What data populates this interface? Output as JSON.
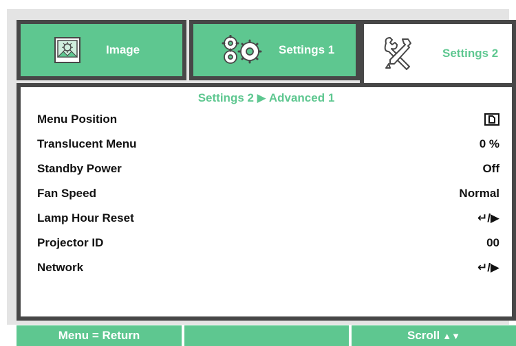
{
  "tabs": {
    "image": {
      "label": "Image",
      "icon": "image-icon"
    },
    "settings1": {
      "label": "Settings 1",
      "icon": "gears-icon"
    },
    "settings2": {
      "label": "Settings 2",
      "icon": "tools-icon"
    }
  },
  "breadcrumb": "Settings 2 ▶ Advanced 1",
  "menu_items": [
    {
      "label": "Menu Position",
      "value": "",
      "value_icon": "menu-position-icon"
    },
    {
      "label": "Translucent Menu",
      "value": "0 %"
    },
    {
      "label": "Standby Power",
      "value": "Off"
    },
    {
      "label": "Fan Speed",
      "value": "Normal"
    },
    {
      "label": "Lamp Hour Reset",
      "value": "↵/▶"
    },
    {
      "label": "Projector ID",
      "value": "00"
    },
    {
      "label": "Network",
      "value": "↵/▶"
    }
  ],
  "footer": {
    "left": "Menu = Return",
    "middle": "",
    "right": "Scroll",
    "right_arrows": "▲▼"
  },
  "colors": {
    "accent_green": "#5ec790",
    "border_dark": "#474747",
    "panel_gray": "#e4e4e4"
  }
}
